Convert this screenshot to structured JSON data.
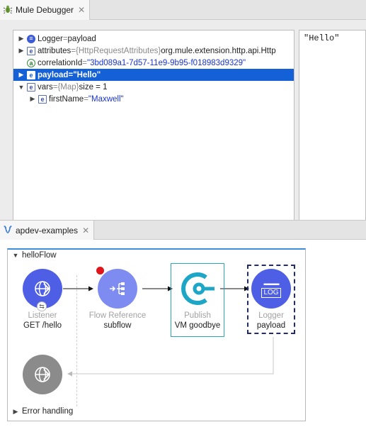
{
  "debugger": {
    "tab_title": "Mule Debugger",
    "tab_close": "✕",
    "value_panel_text": "\"Hello\"",
    "tree": [
      {
        "icon": "logger",
        "name": "Logger",
        "sep": " = ",
        "value": "payload",
        "expanded": false,
        "selected": false
      },
      {
        "icon": "e",
        "name": "attributes",
        "sep": " = ",
        "type": "{HttpRequestAttributes}",
        "value": " org.mule.extension.http.api.Http",
        "expanded": false,
        "selected": false
      },
      {
        "icon": "a",
        "name": "correlationId",
        "sep": " = ",
        "value": "\"3bd089a1-7d57-11e9-9b95-f018983d9329\"",
        "expanded": null,
        "selected": false
      },
      {
        "icon": "e",
        "name": "payload",
        "sep": " = ",
        "value": "\"Hello\"",
        "expanded": false,
        "selected": true
      },
      {
        "icon": "e",
        "name": "vars",
        "sep": " = ",
        "type": "{Map}",
        "value": " size = 1",
        "expanded": true,
        "selected": false
      },
      {
        "icon": "e",
        "name": "firstName",
        "sep": " = ",
        "value": "\"Maxwell\"",
        "expanded": false,
        "selected": false
      }
    ]
  },
  "flow_editor": {
    "tab_title": "apdev-examples",
    "tab_close": "✕",
    "flow_name": "helloFlow",
    "error_handling": "Error handling",
    "nodes": {
      "listener": {
        "type": "Listener",
        "label": "GET /hello"
      },
      "flow_reference": {
        "type": "Flow Reference",
        "label": "subflow"
      },
      "publish": {
        "type": "Publish",
        "label": "VM goodbye"
      },
      "logger": {
        "type": "Logger",
        "label": "payload",
        "icon_text": "LOG"
      }
    }
  },
  "colors": {
    "selection": "#1460d6",
    "node_blue": "#4e5fe6",
    "node_gray": "#8b8b8b",
    "breakpoint": "#e0141b",
    "publish_border": "#2aa6c4",
    "flow_header": "#3a8fd8"
  }
}
